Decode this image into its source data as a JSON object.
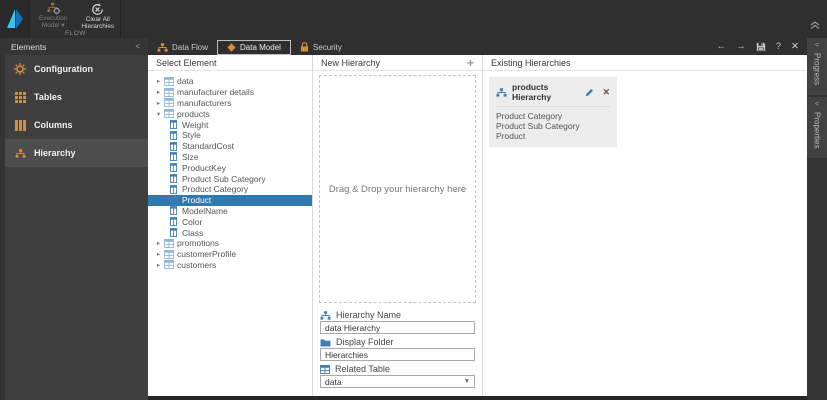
{
  "ribbon": {
    "buttons": [
      {
        "label": "Execution Model",
        "icon": "flow-gear",
        "disabled": true,
        "dropdown": true
      },
      {
        "label": "Clear All Hierarchies",
        "icon": "clear-circle",
        "disabled": false,
        "dropdown": false
      }
    ],
    "group_label": "FLOW"
  },
  "sidebar": {
    "title": "Elements",
    "collapse_glyph": "<",
    "items": [
      {
        "label": "Configuration",
        "icon": "gear",
        "selected": false
      },
      {
        "label": "Tables",
        "icon": "table",
        "selected": false
      },
      {
        "label": "Columns",
        "icon": "columns",
        "selected": false
      },
      {
        "label": "Hierarchy",
        "icon": "hierarchy",
        "selected": true
      }
    ]
  },
  "tabs": [
    {
      "label": "Data Flow",
      "icon": "sitemap",
      "active": false
    },
    {
      "label": "Data Model",
      "icon": "diamond",
      "active": true
    },
    {
      "label": "Security",
      "icon": "lock",
      "active": false
    }
  ],
  "window_controls": [
    {
      "name": "back",
      "glyph": "←"
    },
    {
      "name": "forward",
      "glyph": "→"
    },
    {
      "name": "save",
      "glyph": ""
    },
    {
      "name": "help",
      "glyph": "?"
    },
    {
      "name": "close",
      "glyph": "✕"
    }
  ],
  "right_rail": {
    "collapse_glyph": "<",
    "sections": [
      {
        "label": "Progress"
      },
      {
        "label": "Properties"
      }
    ]
  },
  "select_element_panel": {
    "title": "Select Element",
    "tree": [
      {
        "label": "data",
        "depth": 0,
        "icon": "table-lite",
        "expanded": false,
        "selected": false
      },
      {
        "label": "manufacturer details",
        "depth": 0,
        "icon": "table-lite",
        "expanded": false,
        "selected": false
      },
      {
        "label": "manufacturers",
        "depth": 0,
        "icon": "table-lite",
        "expanded": false,
        "selected": false
      },
      {
        "label": "products",
        "depth": 0,
        "icon": "table-lite",
        "expanded": true,
        "selected": false
      },
      {
        "label": "Weight",
        "depth": 1,
        "icon": "column-blue",
        "selected": false
      },
      {
        "label": "Style",
        "depth": 1,
        "icon": "column-blue",
        "selected": false
      },
      {
        "label": "StandardCost",
        "depth": 1,
        "icon": "column-blue",
        "selected": false
      },
      {
        "label": "Size",
        "depth": 1,
        "icon": "column-blue",
        "selected": false
      },
      {
        "label": "ProductKey",
        "depth": 1,
        "icon": "column-blue",
        "selected": false
      },
      {
        "label": "Product Sub Category",
        "depth": 1,
        "icon": "column-blue",
        "selected": false
      },
      {
        "label": "Product Category",
        "depth": 1,
        "icon": "column-blue",
        "selected": false
      },
      {
        "label": "Product",
        "depth": 1,
        "icon": "column-blue",
        "selected": true
      },
      {
        "label": "ModelName",
        "depth": 1,
        "icon": "column-blue",
        "selected": false
      },
      {
        "label": "Color",
        "depth": 1,
        "icon": "column-blue",
        "selected": false
      },
      {
        "label": "Class",
        "depth": 1,
        "icon": "column-blue",
        "selected": false
      },
      {
        "label": "promotions",
        "depth": 0,
        "icon": "table-lite",
        "expanded": false,
        "selected": false
      },
      {
        "label": "customerProfile",
        "depth": 0,
        "icon": "table-lite",
        "expanded": false,
        "selected": false
      },
      {
        "label": "customers",
        "depth": 0,
        "icon": "table-lite",
        "expanded": false,
        "selected": false
      }
    ]
  },
  "new_hierarchy_panel": {
    "title": "New Hierarchy",
    "add_button": "+",
    "dropzone_text": "Drag & Drop your hierarchy here",
    "fields": [
      {
        "label": "Hierarchy Name",
        "icon": "hierarchy-blue",
        "value": "data Hierarchy",
        "control": "input"
      },
      {
        "label": "Display Folder",
        "icon": "folder-blue",
        "value": "Hierarchies",
        "control": "input"
      },
      {
        "label": "Related Table",
        "icon": "table-blue",
        "value": "data",
        "control": "select"
      }
    ]
  },
  "existing_hierarchies_panel": {
    "title": "Existing Hierarchies",
    "cards": [
      {
        "name": "products Hierarchy",
        "icon": "hierarchy-blue",
        "levels": [
          "Product Category",
          "Product Sub Category",
          "Product"
        ]
      }
    ]
  },
  "colors": {
    "accent_orange": "#d78f3c",
    "accent_blue": "#3d7fb5",
    "selection_blue": "#2e79ad"
  }
}
